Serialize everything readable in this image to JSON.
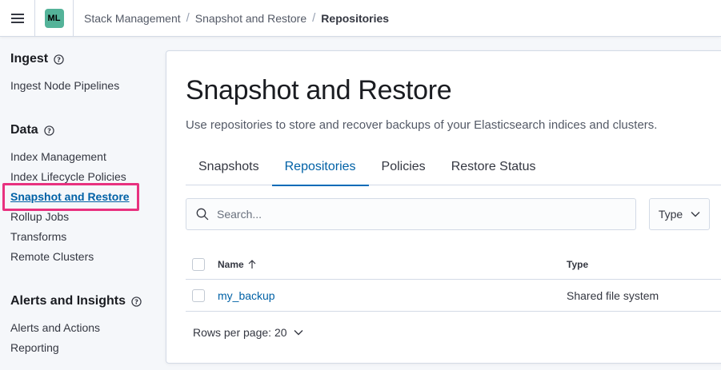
{
  "header": {
    "space_initials": "ML",
    "breadcrumbs": [
      "Stack Management",
      "Snapshot and Restore",
      "Repositories"
    ]
  },
  "sidebar": {
    "sections": [
      {
        "title": "Ingest",
        "items": [
          "Ingest Node Pipelines"
        ]
      },
      {
        "title": "Data",
        "items": [
          "Index Management",
          "Index Lifecycle Policies",
          "Snapshot and Restore",
          "Rollup Jobs",
          "Transforms",
          "Remote Clusters"
        ]
      },
      {
        "title": "Alerts and Insights",
        "items": [
          "Alerts and Actions",
          "Reporting"
        ]
      }
    ],
    "active_item": "Snapshot and Restore"
  },
  "main": {
    "title": "Snapshot and Restore",
    "description": "Use repositories to store and recover backups of your Elasticsearch indices and clusters.",
    "tabs": [
      "Snapshots",
      "Repositories",
      "Policies",
      "Restore Status"
    ],
    "selected_tab": "Repositories",
    "search": {
      "placeholder": "Search..."
    },
    "type_filter_label": "Type",
    "table": {
      "columns": [
        "Name",
        "Type"
      ],
      "rows": [
        {
          "name": "my_backup",
          "type": "Shared file system"
        }
      ]
    },
    "pagination_label": "Rows per page: 20"
  },
  "colors": {
    "accent": "#0061a6",
    "highlight": "#e8317f",
    "avatar": "#54b399"
  }
}
